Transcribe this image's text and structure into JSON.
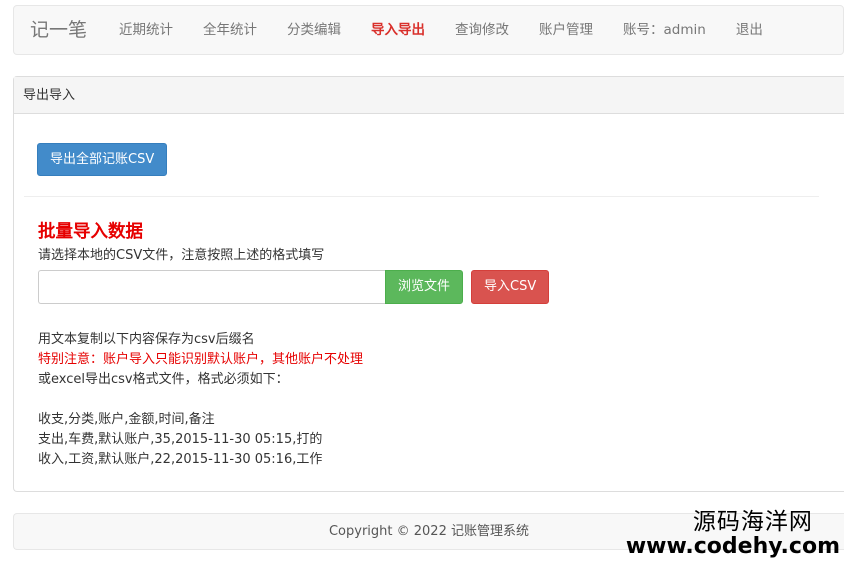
{
  "navbar": {
    "brand": "记一笔",
    "items": [
      {
        "label": "近期统计",
        "active": false
      },
      {
        "label": "全年统计",
        "active": false
      },
      {
        "label": "分类编辑",
        "active": false
      },
      {
        "label": "导入导出",
        "active": true
      },
      {
        "label": "查询修改",
        "active": false
      },
      {
        "label": "账户管理",
        "active": false
      },
      {
        "label": "账号：admin",
        "active": false
      },
      {
        "label": "退出",
        "active": false
      }
    ]
  },
  "panel": {
    "title": "导出导入",
    "export_button": "导出全部记账CSV",
    "import_title": "批量导入数据",
    "import_hint": "请选择本地的CSV文件，注意按照上述的格式填写",
    "file_input_value": "",
    "browse_button": "浏览文件",
    "import_button": "导入CSV",
    "instructions": {
      "line1": "用文本复制以下内容保存为csv后缀名",
      "warning": "特别注意：账户导入只能识别默认账户，其他账户不处理",
      "line3": "或excel导出csv格式文件，格式必须如下：",
      "sample_header": "收支,分类,账户,金额,时间,备注",
      "sample_row1": "支出,车费,默认账户,35,2015-11-30 05:15,打的",
      "sample_row2": "收入,工资,默认账户,22,2015-11-30 05:16,工作"
    }
  },
  "footer": {
    "copyright": "Copyright © 2022 记账管理系统"
  },
  "watermark": {
    "cn": "源码海洋网",
    "en": "www.codehy.com"
  },
  "colors": {
    "active_nav": "#d9302b",
    "primary": "#428bca",
    "success": "#5cb85c",
    "danger": "#d9534f",
    "warning_text": "#e60000"
  }
}
